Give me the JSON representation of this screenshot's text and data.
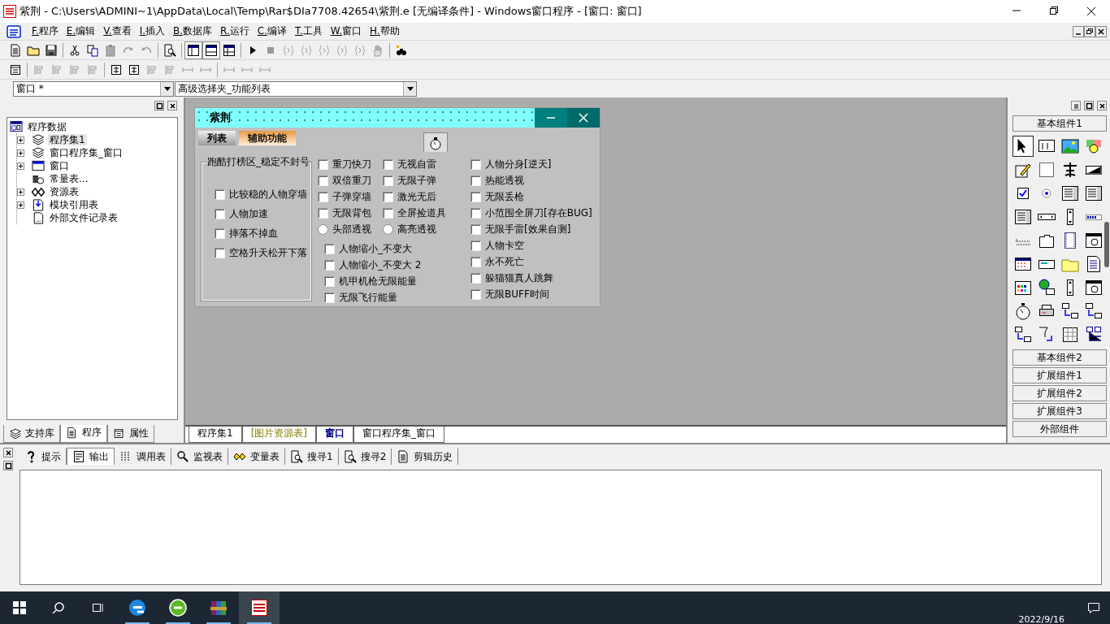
{
  "window": {
    "title": "紫荆 - C:\\Users\\ADMINI~1\\AppData\\Local\\Temp\\Rar$DIa7708.42654\\紫荆.e [无编译条件] - Windows窗口程序 - [窗口: 窗口]"
  },
  "menu": [
    "F.程序",
    "E.编辑",
    "V.查看",
    "I.插入",
    "B.数据库",
    "R.运行",
    "C.编译",
    "T.工具",
    "W.窗口",
    "H.帮助"
  ],
  "selectors": [
    {
      "value": "窗口 *"
    },
    {
      "value": "高级选择夹_功能列表"
    }
  ],
  "project_tree": {
    "label": "程序数据",
    "kind": "root",
    "selected": false,
    "children": [
      {
        "label": "程序集1",
        "kind": "module",
        "selected": true,
        "expanded": false
      },
      {
        "label": "窗口程序集_窗口",
        "kind": "module",
        "selected": false,
        "expanded": false
      },
      {
        "label": "窗口",
        "kind": "window",
        "selected": false,
        "expanded": false
      },
      {
        "label": "常量表...",
        "kind": "constants",
        "selected": false
      },
      {
        "label": "资源表",
        "kind": "resources",
        "selected": false,
        "expanded": false
      },
      {
        "label": "模块引用表",
        "kind": "library",
        "selected": false,
        "expanded": false
      },
      {
        "label": "外部文件记录表",
        "kind": "file",
        "selected": false
      }
    ]
  },
  "left_tabs": [
    {
      "label": "支持库",
      "kind": "library",
      "selected": false
    },
    {
      "label": "程序",
      "kind": "program",
      "selected": true
    },
    {
      "label": "属性",
      "kind": "properties",
      "selected": false
    }
  ],
  "form": {
    "title": "紫荆",
    "tabs": [
      {
        "label": "列表",
        "selected": false
      },
      {
        "label": "辅助功能",
        "selected": true
      }
    ],
    "group": {
      "label": "跑酷打榜区_稳定不封号",
      "items": [
        {
          "label": "比较稳的人物穿墙",
          "checked": false
        },
        {
          "label": "人物加速",
          "checked": false
        },
        {
          "label": "摔落不掉血",
          "checked": false
        },
        {
          "label": "空格升天松开下落",
          "checked": false
        }
      ]
    },
    "grid": [
      {
        "kind": "checkbox",
        "label": "重刀快刀",
        "checked": false
      },
      {
        "kind": "checkbox",
        "label": "无视自雷",
        "checked": false
      },
      {
        "kind": "checkbox",
        "label": "双倍重刀",
        "checked": false
      },
      {
        "kind": "checkbox",
        "label": "无限子弹",
        "checked": false
      },
      {
        "kind": "checkbox",
        "label": "子弹穿墙",
        "checked": false
      },
      {
        "kind": "checkbox",
        "label": "激光无后",
        "checked": false
      },
      {
        "kind": "checkbox",
        "label": "无限背包",
        "checked": false
      },
      {
        "kind": "checkbox",
        "label": "全屏捡道具",
        "checked": false
      },
      {
        "kind": "radio",
        "label": "头部透视",
        "selected": false
      },
      {
        "kind": "radio",
        "label": "高亮透视",
        "selected": false
      }
    ],
    "lower_list": [
      {
        "label": "人物缩小_不变大",
        "checked": false
      },
      {
        "label": "人物缩小_不变大 2",
        "checked": false
      },
      {
        "label": "机甲机枪无限能量",
        "checked": false
      },
      {
        "label": "无限飞行能量",
        "checked": false
      }
    ],
    "right_list": [
      {
        "label": "人物分身[逆天]",
        "checked": false
      },
      {
        "label": "热能透视",
        "checked": false
      },
      {
        "label": "无限丢枪",
        "checked": false
      },
      {
        "label": "小范围全屏刀[存在BUG]",
        "checked": false
      },
      {
        "label": "无限手雷[效果自测]",
        "checked": false
      },
      {
        "label": "人物卡空",
        "checked": false
      },
      {
        "label": "永不死亡",
        "checked": false
      },
      {
        "label": "躲猫猫真人跳舞",
        "checked": false
      },
      {
        "label": "无限BUFF时间",
        "checked": false
      }
    ]
  },
  "doc_tabs": [
    {
      "label": "程序集1",
      "selected": false
    },
    {
      "label": "[图片资源表]",
      "color": "#808000",
      "selected": false
    },
    {
      "label": "窗口",
      "color": "#000080",
      "selected": true
    },
    {
      "label": "窗口程序集_窗口",
      "selected": false
    }
  ],
  "toolbox": {
    "groups": [
      {
        "label": "基本组件1",
        "expanded": true
      },
      {
        "label": "基本组件2",
        "expanded": false
      },
      {
        "label": "扩展组件1",
        "expanded": false
      },
      {
        "label": "扩展组件2",
        "expanded": false
      },
      {
        "label": "扩展组件3",
        "expanded": false
      },
      {
        "label": "外部组件",
        "expanded": false
      }
    ]
  },
  "output_tabs": [
    {
      "label": "提示",
      "kind": "hint",
      "selected": false
    },
    {
      "label": "输出",
      "kind": "output",
      "selected": true
    },
    {
      "label": "调用表",
      "kind": "calls",
      "selected": false
    },
    {
      "label": "监视表",
      "kind": "watch",
      "selected": false
    },
    {
      "label": "变量表",
      "kind": "variables",
      "selected": false
    },
    {
      "label": "搜寻1",
      "kind": "search",
      "selected": false
    },
    {
      "label": "搜寻2",
      "kind": "search",
      "selected": false
    },
    {
      "label": "剪辑历史",
      "kind": "history",
      "selected": false
    }
  ],
  "taskbar": {
    "apps": [
      {
        "kind": "edge",
        "selected": false
      },
      {
        "kind": "green",
        "selected": false
      },
      {
        "kind": "archive",
        "selected": false
      },
      {
        "kind": "ide",
        "selected": true
      }
    ],
    "clock": "2022/9/16"
  }
}
